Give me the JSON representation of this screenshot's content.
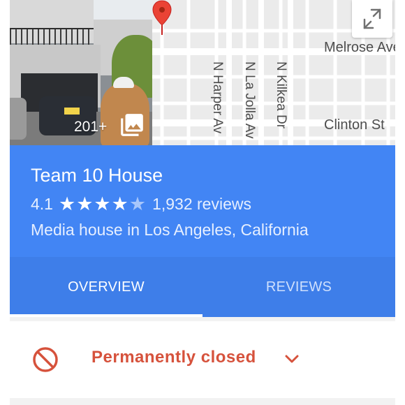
{
  "place": {
    "name": "Team 10 House",
    "rating": "4.1",
    "reviews_count": "1,932 reviews",
    "stars_filled": 4,
    "category_location": "Media house in Los Angeles, California"
  },
  "photo": {
    "count_label": "201+"
  },
  "map": {
    "street_labels": {
      "melrose": "Melrose Ave",
      "clinton": "Clinton St",
      "harper": "N Harper Av",
      "la_jolla": "N La Jolla Av",
      "kilkea": "N Kilkea Dr"
    }
  },
  "tabs": {
    "overview": "OVERVIEW",
    "reviews": "REVIEWS",
    "active": "overview"
  },
  "status": {
    "label": "Permanently closed"
  },
  "icons": {
    "gallery": "photo-gallery-icon",
    "expand": "expand-map-icon",
    "pin": "map-pin-icon",
    "closed": "no-entry-icon",
    "chevron": "chevron-down-icon"
  },
  "colors": {
    "primary_blue": "#4285f4",
    "tab_bar_blue": "#3e7ee9",
    "closed_red": "#d6523c",
    "pin_red": "#ea4335"
  }
}
